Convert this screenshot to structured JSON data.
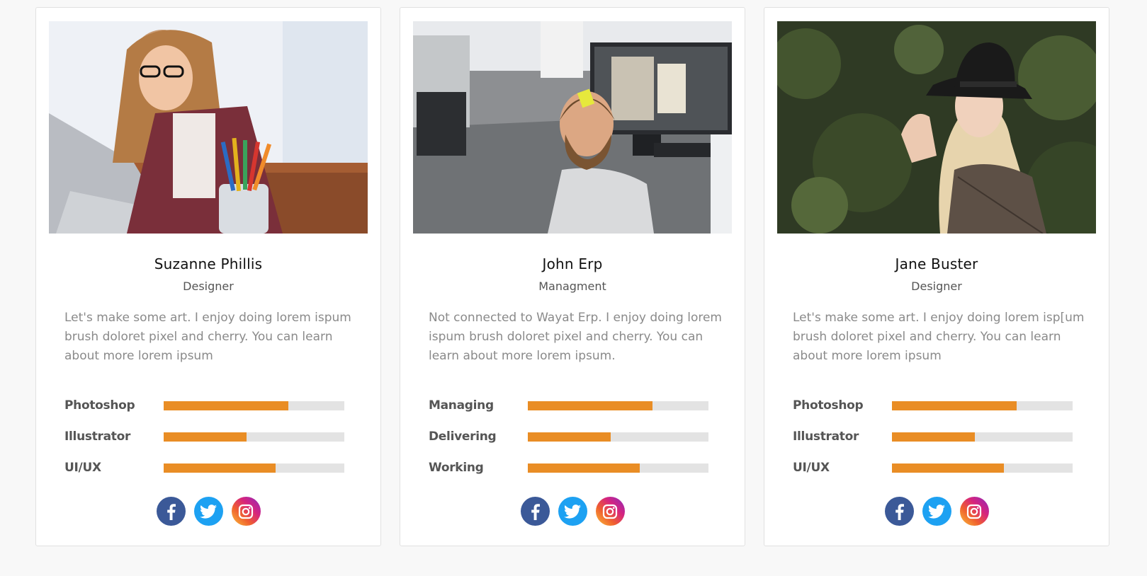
{
  "cards": [
    {
      "name": "Suzanne Phillis",
      "role": "Designer",
      "description": "Let's make some art. I enjoy doing lorem ispum brush doloret pixel and cherry. You can learn about more lorem ipsum",
      "skills": [
        {
          "label": "Photoshop",
          "level": 0.69
        },
        {
          "label": "Illustrator",
          "level": 0.46
        },
        {
          "label": "UI/UX",
          "level": 0.62
        }
      ]
    },
    {
      "name": "John Erp",
      "role": "Managment",
      "description": "Not connected to Wayat Erp. I enjoy doing lorem ispum brush doloret pixel and cherry. You can learn about more lorem ipsum.",
      "skills": [
        {
          "label": "Managing",
          "level": 0.69
        },
        {
          "label": "Delivering",
          "level": 0.46
        },
        {
          "label": "Working",
          "level": 0.62
        }
      ]
    },
    {
      "name": "Jane Buster",
      "role": "Designer",
      "description": "Let's make some art. I enjoy doing lorem isp[um brush doloret pixel and cherry. You can learn about more lorem ipsum",
      "skills": [
        {
          "label": "Photoshop",
          "level": 0.69
        },
        {
          "label": "Illustrator",
          "level": 0.46
        },
        {
          "label": "UI/UX",
          "level": 0.62
        }
      ]
    }
  ],
  "social_icons": [
    "facebook-icon",
    "twitter-icon",
    "instagram-icon"
  ],
  "colors": {
    "skill_fill": "#e98d25",
    "skill_track": "#e3e3e3",
    "facebook": "#3b5998",
    "twitter": "#1da1f2"
  }
}
